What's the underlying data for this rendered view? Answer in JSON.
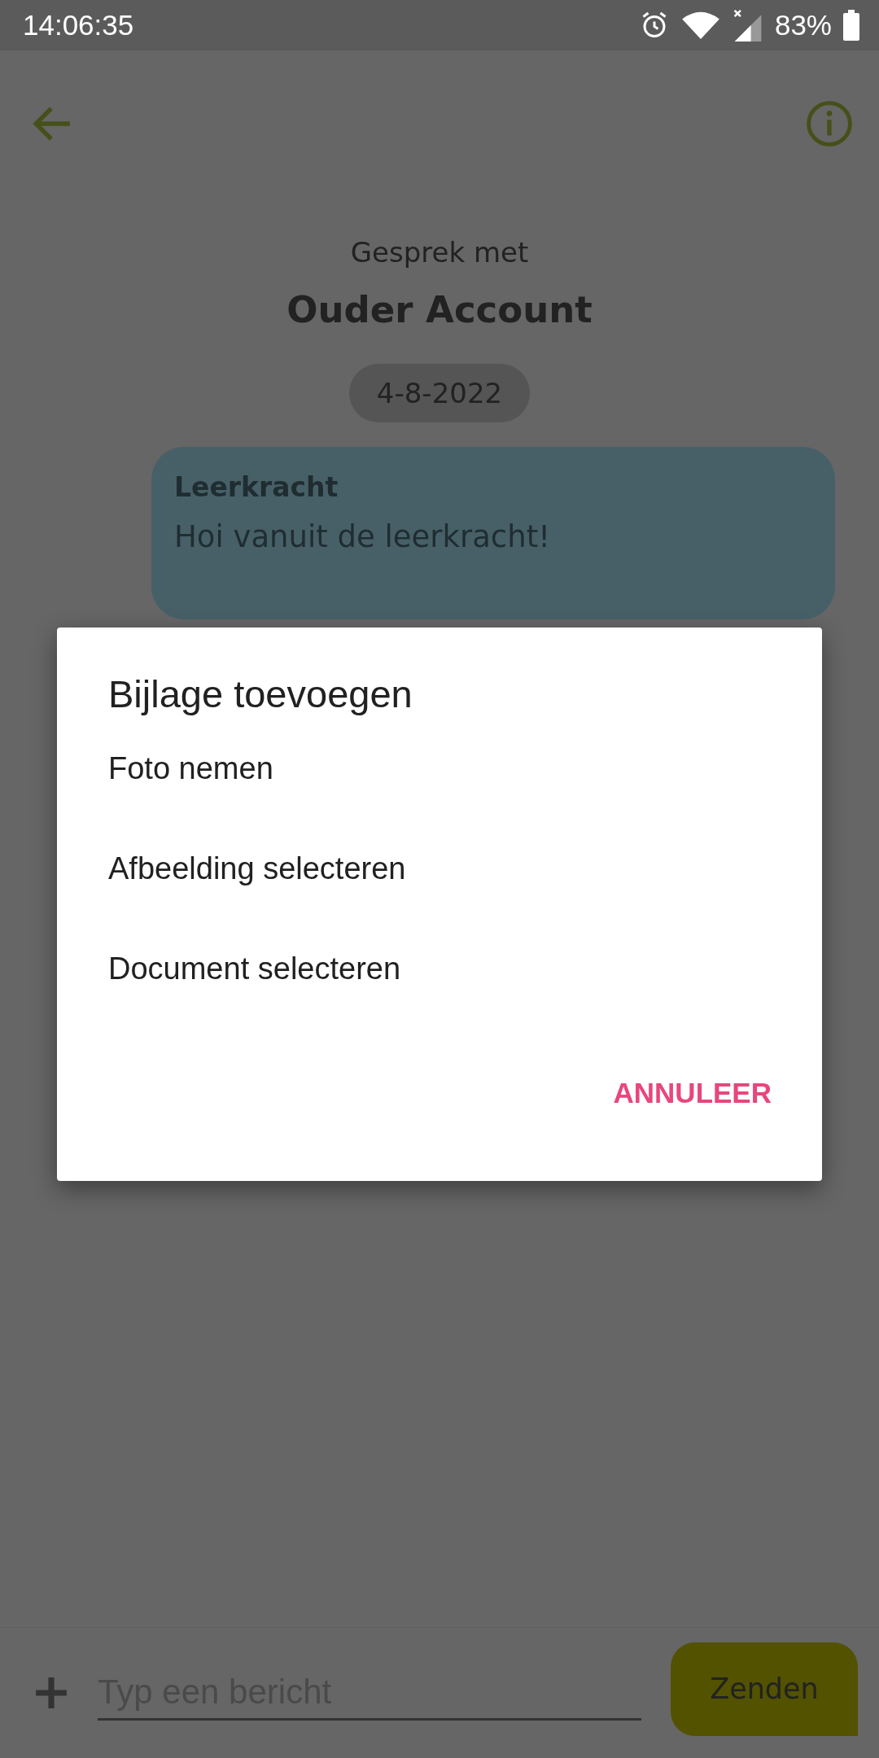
{
  "status_bar": {
    "time": "14:06:35",
    "battery": "83%"
  },
  "header": {
    "subtitle": "Gesprek met",
    "title": "Ouder Account"
  },
  "date_chip": "4-8-2022",
  "messages": [
    {
      "sender": "Leerkracht",
      "text": "Hoi vanuit de leerkracht!"
    }
  ],
  "composer": {
    "placeholder": "Typ een bericht",
    "send_label": "Zenden"
  },
  "dialog": {
    "title": "Bijlage toevoegen",
    "options": [
      "Foto nemen",
      "Afbeelding selecteren",
      "Document selecteren"
    ],
    "cancel": "ANNULEER"
  }
}
